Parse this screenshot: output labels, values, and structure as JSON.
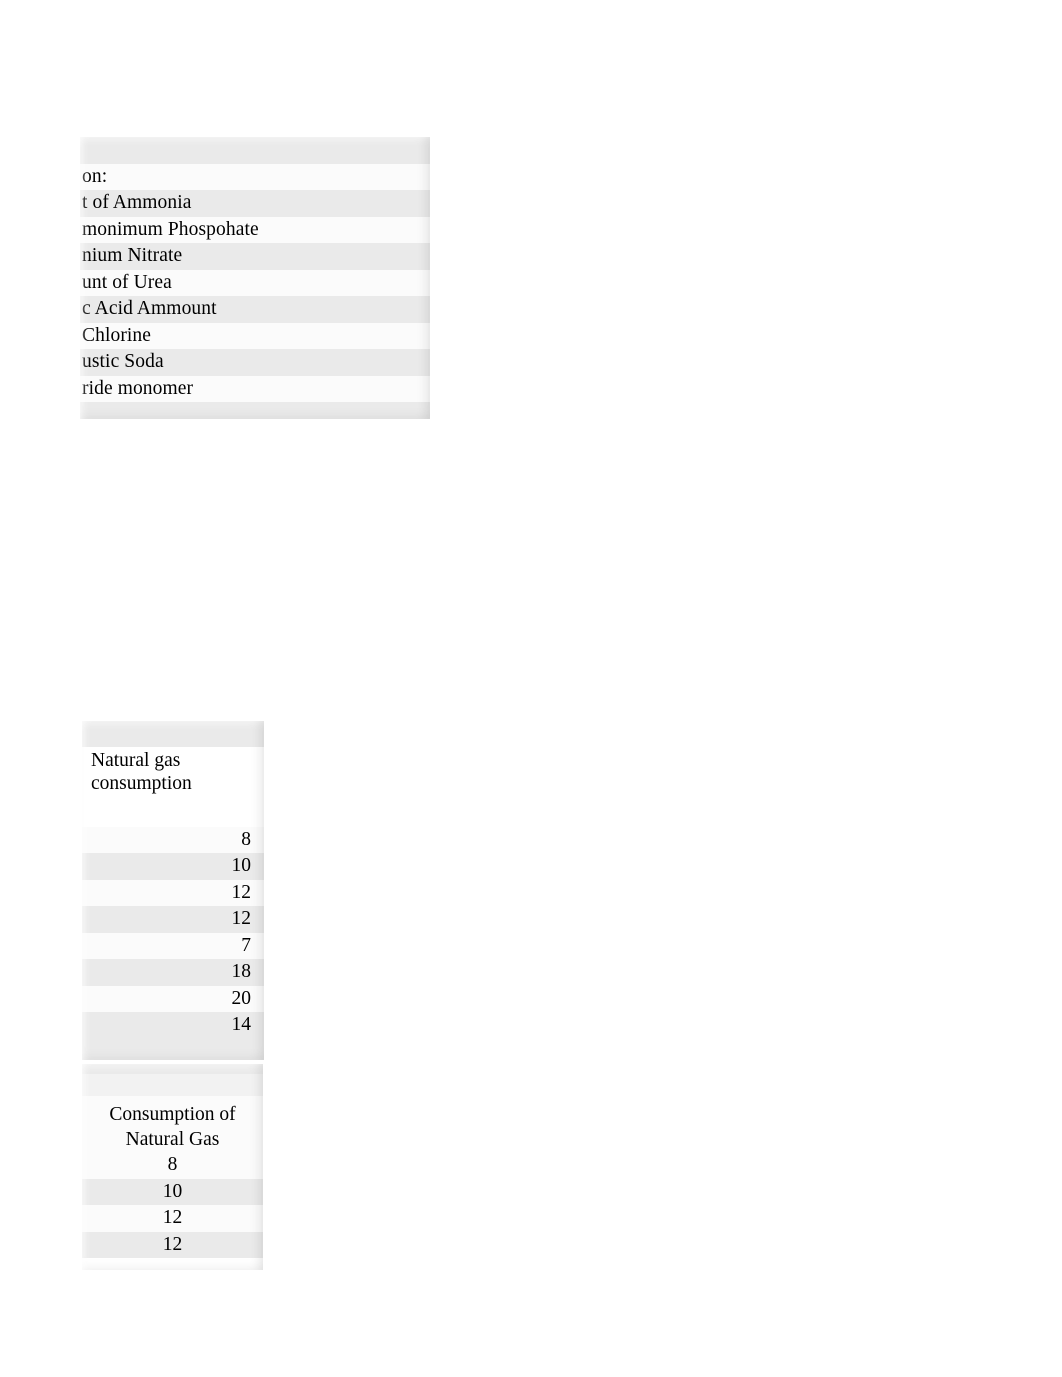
{
  "page": {
    "background_color": "#ffffff",
    "band_color": "#eaeaea",
    "row_color": "#fbfbfb",
    "text_color": "#000000"
  },
  "fragment_chemicals": {
    "name": "chemical-inputs-list",
    "rows": [
      {
        "text": "on:"
      },
      {
        "text": "t of Ammonia"
      },
      {
        "text": "monimum Phospohate"
      },
      {
        "text": "nium Nitrate"
      },
      {
        "text": "unt of Urea"
      },
      {
        "text": "c Acid Ammount"
      },
      {
        "text": "Chlorine"
      },
      {
        "text": "ustic Soda"
      },
      {
        "text": "ride monomer"
      }
    ]
  },
  "fragment_gas_right": {
    "name": "natural-gas-consumption-right",
    "header": "Natural gas consumption",
    "values": [
      "8",
      "10",
      "12",
      "12",
      "7",
      "18",
      "20",
      "14"
    ]
  },
  "fragment_gas_center": {
    "name": "consumption-of-natural-gas-center",
    "header": "Consumption of Natural Gas",
    "values": [
      "8",
      "10",
      "12",
      "12"
    ]
  },
  "chart_data": {
    "type": "table",
    "title": "Consumption of Natural Gas",
    "categories": [
      "on:",
      "t of Ammonia",
      "monimum Phospohate",
      "nium Nitrate",
      "unt of Urea",
      "c Acid Ammount",
      "Chlorine",
      "ustic Soda",
      "ride monomer"
    ],
    "series": [
      {
        "name": "Natural gas consumption",
        "values": [
          8,
          10,
          12,
          12,
          7,
          18,
          20,
          14
        ]
      },
      {
        "name": "Consumption of Natural Gas",
        "values": [
          8,
          10,
          12,
          12
        ]
      }
    ],
    "xlabel": "",
    "ylabel": "Natural gas consumption",
    "grid": false,
    "legend": "none"
  }
}
